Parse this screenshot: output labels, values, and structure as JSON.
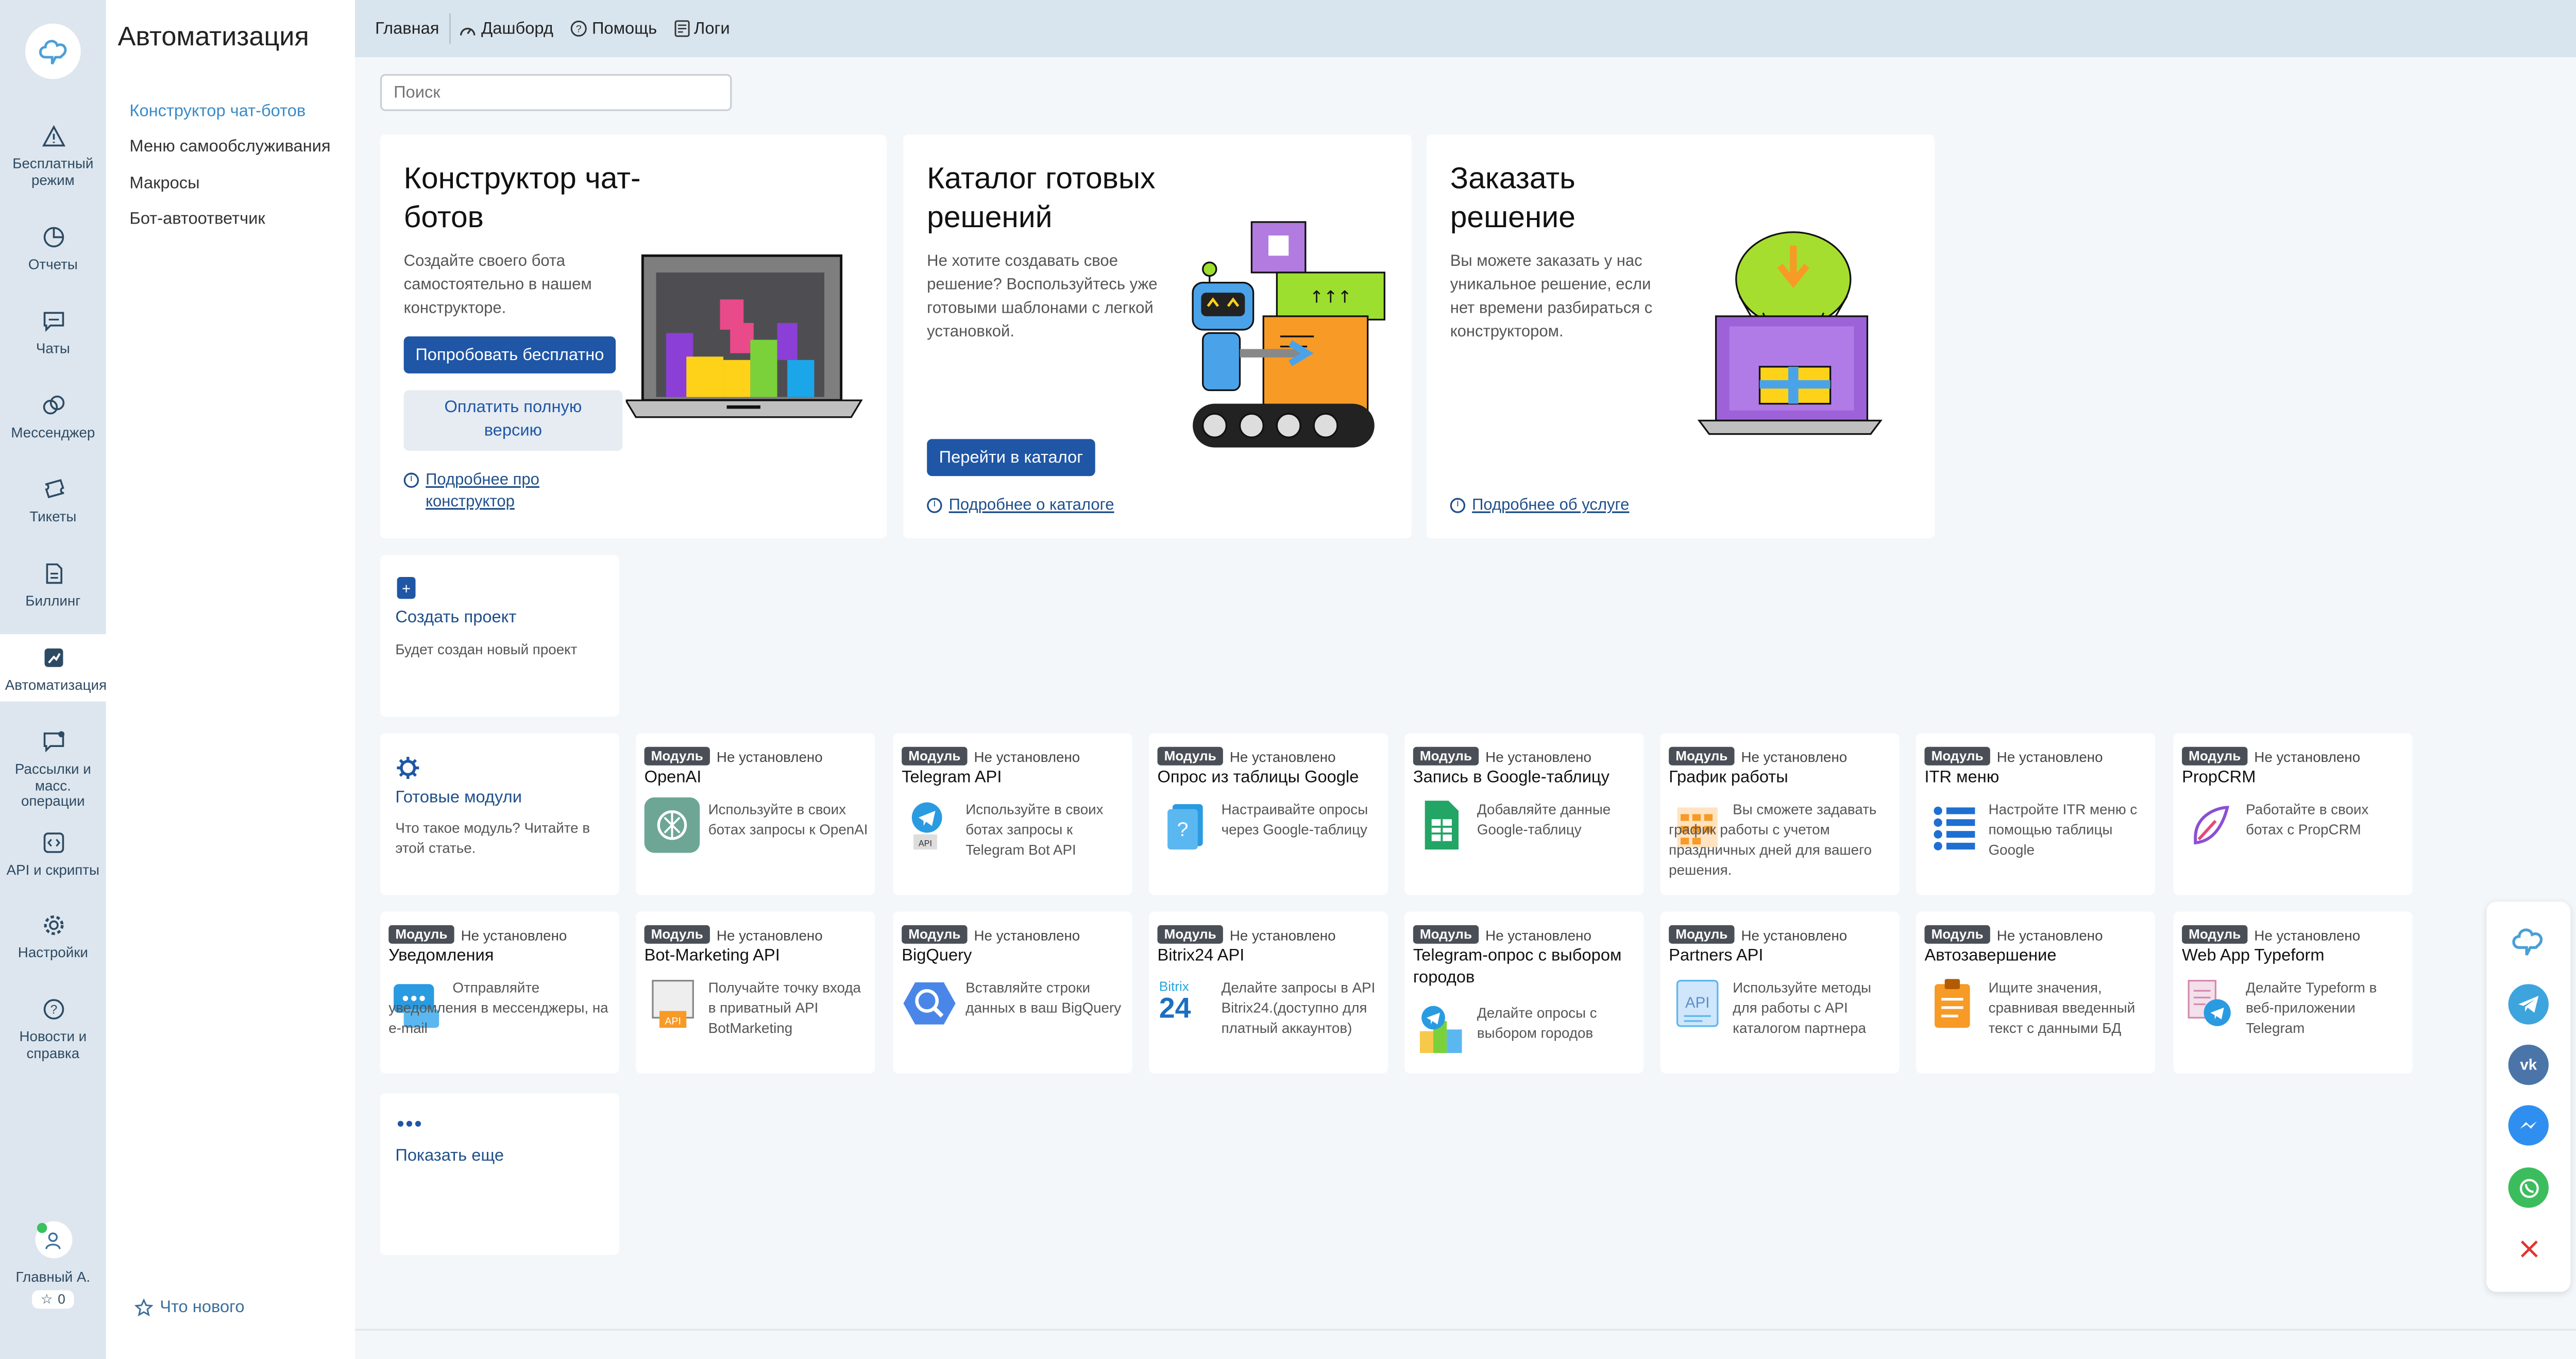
{
  "rail": {
    "items": [
      {
        "label": "Бесплатный режим",
        "icon": "warning-icon"
      },
      {
        "label": "Отчеты",
        "icon": "pie-chart-icon"
      },
      {
        "label": "Чаты",
        "icon": "chat-icon"
      },
      {
        "label": "Мессенджер",
        "icon": "messenger-icon"
      },
      {
        "label": "Тикеты",
        "icon": "ticket-icon"
      },
      {
        "label": "Биллинг",
        "icon": "document-icon"
      },
      {
        "label": "Автоматизация",
        "icon": "automation-icon"
      },
      {
        "label": "Рассылки и масс. операции",
        "icon": "broadcast-icon"
      },
      {
        "label": "API и скрипты",
        "icon": "code-icon"
      },
      {
        "label": "Настройки",
        "icon": "gear-icon"
      },
      {
        "label": "Новости и справка",
        "icon": "help-icon"
      }
    ],
    "user_name": "Главный А.",
    "stars": "0"
  },
  "side": {
    "title": "Автоматизация",
    "links": [
      "Конструктор чат-ботов",
      "Меню самообслуживания",
      "Макросы",
      "Бот-автоответчик"
    ],
    "whats_new": "Что нового"
  },
  "topbar": {
    "home": "Главная",
    "dashboard": "Дашборд",
    "help": "Помощь",
    "logs": "Логи"
  },
  "search": {
    "placeholder": "Поиск"
  },
  "cards": {
    "builder": {
      "title": "Конструктор чат-ботов",
      "desc": "Создайте своего бота самостоятельно в нашем конструкторе.",
      "primary": "Попробовать бесплатно",
      "secondary": "Оплатить полную версию",
      "more": "Подробнее про конструктор"
    },
    "catalog": {
      "title": "Каталог готовых решений",
      "desc": "Не хотите создавать свое решение? Воспользуйтесь уже готовыми шаблонами с легкой установкой.",
      "primary": "Перейти в каталог",
      "more": "Подробнее о каталоге"
    },
    "order": {
      "title": "Заказать решение",
      "desc": "Вы можете заказать у нас уникальное решение, если нет времени разбираться с конструктором.",
      "more": "Подробнее об услуге"
    }
  },
  "create_project": {
    "title": "Создать проект",
    "desc": "Будет создан новый проект"
  },
  "ready_modules": {
    "title": "Готовые модули",
    "desc": "Что такое модуль? Читайте в этой статье."
  },
  "show_more": {
    "title": "Показать еще"
  },
  "module_badge": "Модуль",
  "module_status": "Не установлено",
  "modules_row1": [
    {
      "title": "OpenAI",
      "desc": "Используйте в своих ботах запросы к OpenAI",
      "icon": "openai-icon"
    },
    {
      "title": "Telegram API",
      "desc": "Используйте в своих ботах запросы к Telegram Bot API",
      "icon": "telegram-api-icon"
    },
    {
      "title": "Опрос из таблицы Google",
      "desc": "Настраивайте опросы через Google-таблицу",
      "icon": "google-survey-icon"
    },
    {
      "title": "Запись в Google-таблицу",
      "desc": "Добавляйте данные Google-таблицу",
      "icon": "google-sheets-icon"
    },
    {
      "title": "График работы",
      "desc": "Вы сможете задавать график работы с учетом праздничных дней для вашего решения.",
      "icon": "calendar-icon"
    },
    {
      "title": "ITR меню",
      "desc": "Настройте ITR меню с помощью таблицы Google",
      "icon": "list-menu-icon"
    },
    {
      "title": "PropCRM",
      "desc": "Работайте в своих ботах с PropCRM",
      "icon": "propcrm-icon"
    }
  ],
  "modules_row2": [
    {
      "title": "Уведомления",
      "desc": "Отправляйте уведомления в мессенджеры, на e-mail",
      "icon": "notification-icon"
    },
    {
      "title": "Bot-Marketing API",
      "desc": "Получайте точку входа в приватный API BotMarketing",
      "icon": "bot-marketing-icon"
    },
    {
      "title": "BigQuery",
      "desc": "Вставляйте строки данных в ваш BigQuery",
      "icon": "bigquery-icon"
    },
    {
      "title": "Bitrix24 API",
      "desc": "Делайте запросы в API Bitrix24.(доступно для платный аккаунтов)",
      "icon": "bitrix24-icon"
    },
    {
      "title": "Telegram-опрос с выбором городов",
      "desc": "Делайте опросы с выбором городов",
      "icon": "telegram-city-icon"
    },
    {
      "title": "Partners API",
      "desc": "Используйте методы для работы с API каталогом партнера",
      "icon": "partners-api-icon"
    },
    {
      "title": "Автозавершение",
      "desc": "Ищите значения, сравнивая введенный текст с данными БД",
      "icon": "clipboard-icon"
    },
    {
      "title": "Web App Typeform",
      "desc": "Делайте Typeform в веб-приложении Telegram",
      "icon": "typeform-icon"
    }
  ],
  "bitrix_logo": {
    "top": "Bitrix",
    "bottom": "24"
  },
  "api_label": "API",
  "colors": {
    "primary": "#1f56a6",
    "rail": "#dde6ee",
    "topbar": "#d9e5ee",
    "link": "#1f4f8a"
  }
}
